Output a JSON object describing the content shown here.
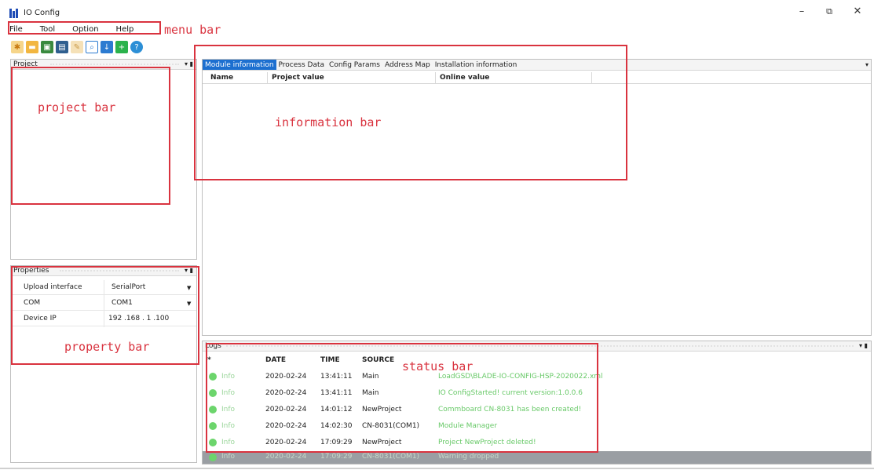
{
  "window": {
    "title": "IO Config",
    "controls": [
      "–",
      "⧉",
      "✕"
    ]
  },
  "menu": {
    "items": [
      "File",
      "Tool",
      "Option",
      "Help"
    ]
  },
  "toolbar": {
    "icons": [
      "new-project-icon",
      "open-icon",
      "save-icon",
      "save-as-icon",
      "config-icon",
      "search-icon",
      "download-icon",
      "add-icon",
      "help-icon"
    ]
  },
  "project_panel": {
    "title": "Project"
  },
  "properties_panel": {
    "title": "Properties",
    "rows": [
      {
        "label": "Upload interface",
        "value": "SerialPort",
        "dropdown": true
      },
      {
        "label": "COM",
        "value": "COM1",
        "dropdown": true
      },
      {
        "label": "Device IP",
        "value": "192 .168 . 1 .100",
        "dropdown": false
      }
    ]
  },
  "info_panel": {
    "tabs": [
      "Module information",
      "Process Data",
      "Config Params",
      "Address Map",
      "Installation information"
    ],
    "active_tab": 0,
    "columns": [
      "Name",
      "Project value",
      "Online value"
    ]
  },
  "logs_panel": {
    "title": "Logs",
    "columns": [
      "*",
      "DATE",
      "TIME",
      "SOURCE"
    ],
    "rows": [
      {
        "level": "Info",
        "date": "2020-02-24",
        "time": "13:41:11",
        "source": "Main",
        "message": "LoadGSD\\BLADE-IO-CONFIG-HSP-2020022.xml"
      },
      {
        "level": "Info",
        "date": "2020-02-24",
        "time": "13:41:11",
        "source": "Main",
        "message": "IO ConfigStarted! current version:1.0.0.6"
      },
      {
        "level": "Info",
        "date": "2020-02-24",
        "time": "14:01:12",
        "source": "NewProject",
        "message": "Commboard CN-8031 has been created!"
      },
      {
        "level": "Info",
        "date": "2020-02-24",
        "time": "14:02:30",
        "source": "CN-8031(COM1)",
        "message": "Module Manager"
      },
      {
        "level": "Info",
        "date": "2020-02-24",
        "time": "17:09:29",
        "source": "NewProject",
        "message": "Project NewProject deleted!"
      },
      {
        "level": "Info",
        "date": "2020-02-24",
        "time": "17:09:29",
        "source": "CN-8031(COM1)",
        "message": "Warning dropped"
      }
    ]
  },
  "annotations": {
    "menu_bar": "menu bar",
    "project_bar": "project bar",
    "information_bar": "information bar",
    "property_bar": "property bar",
    "status_bar": "status bar",
    "color": "#d9333f"
  }
}
